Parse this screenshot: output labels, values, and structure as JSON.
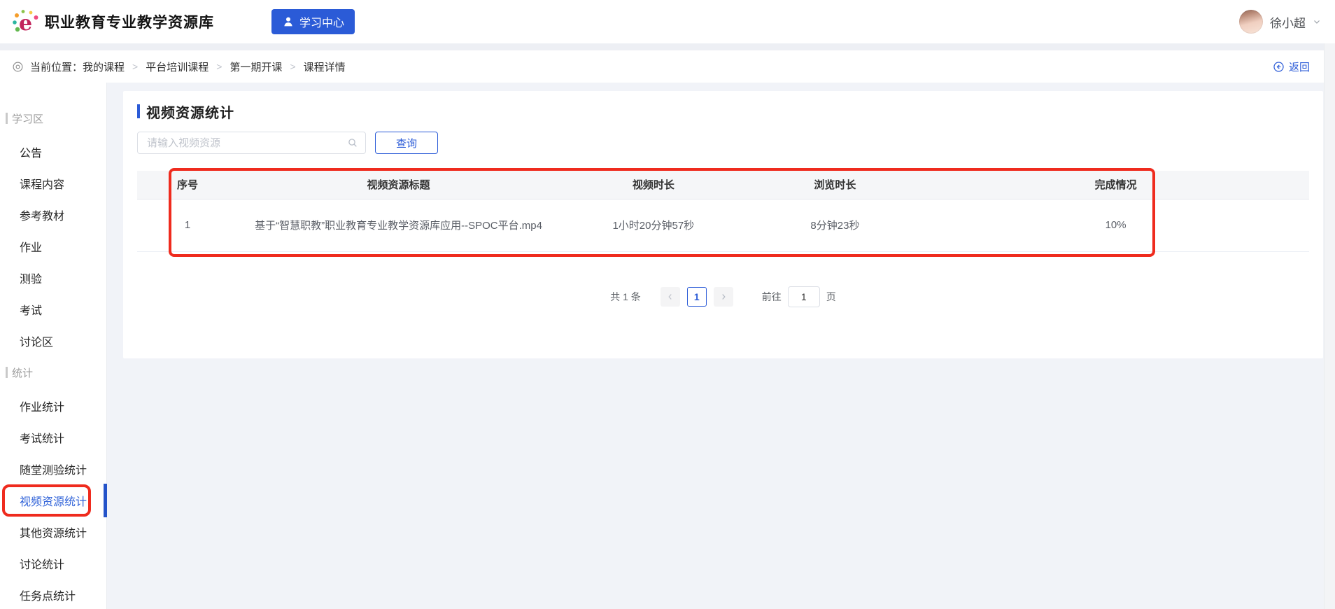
{
  "header": {
    "app_title": "职业教育专业教学资源库",
    "learning_center_label": "学习中心",
    "username": "徐小超"
  },
  "breadcrumb": {
    "prefix": "当前位置：",
    "items": [
      "我的课程",
      "平台培训课程",
      "第一期开课",
      "课程详情"
    ],
    "separator": ">",
    "back_label": "返回"
  },
  "sidebar": {
    "sections": [
      {
        "label": "学习区",
        "items": [
          {
            "label": "公告"
          },
          {
            "label": "课程内容"
          },
          {
            "label": "参考教材"
          },
          {
            "label": "作业"
          },
          {
            "label": "测验"
          },
          {
            "label": "考试"
          },
          {
            "label": "讨论区"
          }
        ]
      },
      {
        "label": "统计",
        "items": [
          {
            "label": "作业统计"
          },
          {
            "label": "考试统计"
          },
          {
            "label": "随堂测验统计"
          },
          {
            "label": "视频资源统计",
            "active": true,
            "annotated": true
          },
          {
            "label": "其他资源统计"
          },
          {
            "label": "讨论统计"
          },
          {
            "label": "任务点统计"
          }
        ]
      }
    ]
  },
  "main": {
    "section_title": "视频资源统计",
    "search": {
      "placeholder": "请输入视频资源",
      "query_button_label": "查询"
    },
    "table": {
      "columns": [
        "序号",
        "视频资源标题",
        "视频时长",
        "浏览时长",
        "完成情况"
      ],
      "rows": [
        {
          "index": "1",
          "title": "基于“智慧职教”职业教育专业教学资源库应用--SPOC平台.mp4",
          "video_duration": "1小时20分钟57秒",
          "view_duration": "8分钟23秒",
          "completion": "10%"
        }
      ]
    },
    "pagination": {
      "total_label": "共 1 条",
      "current_page": "1",
      "goto_label": "前往",
      "goto_value": "1",
      "page_unit_label": "页"
    }
  },
  "colors": {
    "primary_blue": "#2b5bd7",
    "annotation_red": "#ef2b1e",
    "page_background": "#f1f3f8"
  },
  "icons": {
    "logo": "colorful-e-logo",
    "learning_center": "person",
    "user_menu": "chevron-down",
    "breadcrumb_location": "target-circle",
    "back": "circled-arrow-left",
    "search": "magnifier",
    "pagination_prev": "chevron-left",
    "pagination_next": "chevron-right"
  }
}
